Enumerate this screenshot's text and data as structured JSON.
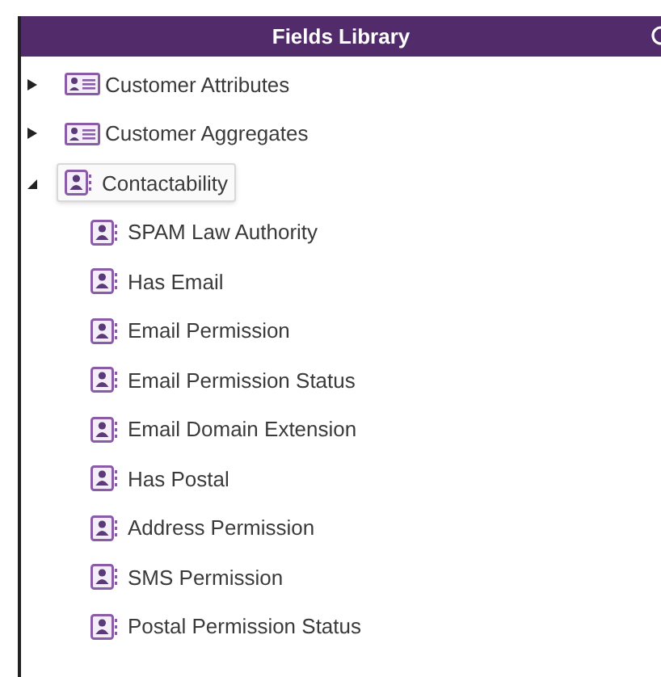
{
  "panel": {
    "title": "Fields Library"
  },
  "tree": [
    {
      "label": "Customer Attributes",
      "kind": "group",
      "expanded": false,
      "selected": false
    },
    {
      "label": "Customer Aggregates",
      "kind": "group",
      "expanded": false,
      "selected": false
    },
    {
      "label": "Contactability",
      "kind": "folder",
      "expanded": true,
      "selected": true,
      "children": [
        {
          "label": "SPAM Law Authority",
          "kind": "field",
          "selected": false
        },
        {
          "label": "Has Email",
          "kind": "field",
          "selected": false
        },
        {
          "label": "Email Permission",
          "kind": "field",
          "selected": false
        },
        {
          "label": "Email Permission Status",
          "kind": "field",
          "selected": false
        },
        {
          "label": "Email Domain Extension",
          "kind": "field",
          "selected": false
        },
        {
          "label": "Has Postal",
          "kind": "field",
          "selected": false
        },
        {
          "label": "Address Permission",
          "kind": "field",
          "selected": false
        },
        {
          "label": "SMS Permission",
          "kind": "field",
          "selected": false
        },
        {
          "label": "Postal Permission Status",
          "kind": "field",
          "selected": false
        }
      ]
    }
  ]
}
